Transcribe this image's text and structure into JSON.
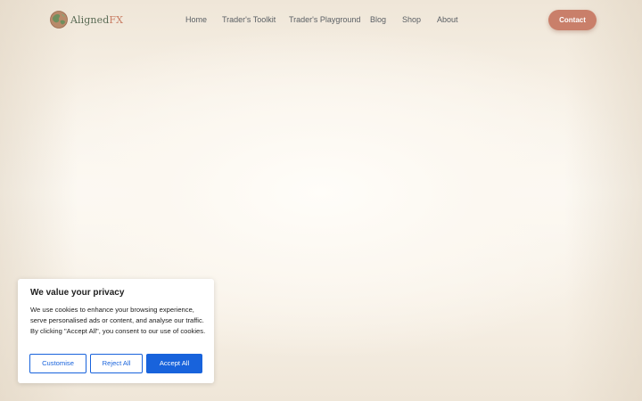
{
  "header": {
    "logo": {
      "name_main": "Aligned",
      "name_accent": "FX",
      "icon": "globe-logo-icon"
    },
    "nav": [
      {
        "label": "Home"
      },
      {
        "label": "Trader's Toolkit"
      },
      {
        "label": "Trader's Playground"
      },
      {
        "label": "Blog"
      },
      {
        "label": "Shop"
      },
      {
        "label": "About"
      }
    ],
    "contact_label": "Contact"
  },
  "cookie_banner": {
    "title": "We value your privacy",
    "body": "We use cookies to enhance your browsing experience, serve personalised ads or content, and analyse our traffic. By clicking \"Accept All\", you consent to our use of cookies.",
    "buttons": {
      "customise": "Customise",
      "reject": "Reject All",
      "accept": "Accept All"
    }
  },
  "colors": {
    "accent": "#c97f6a",
    "consent_blue": "#1863dc",
    "nav_text": "#5a5f64",
    "logo_green": "#5a6b55"
  }
}
